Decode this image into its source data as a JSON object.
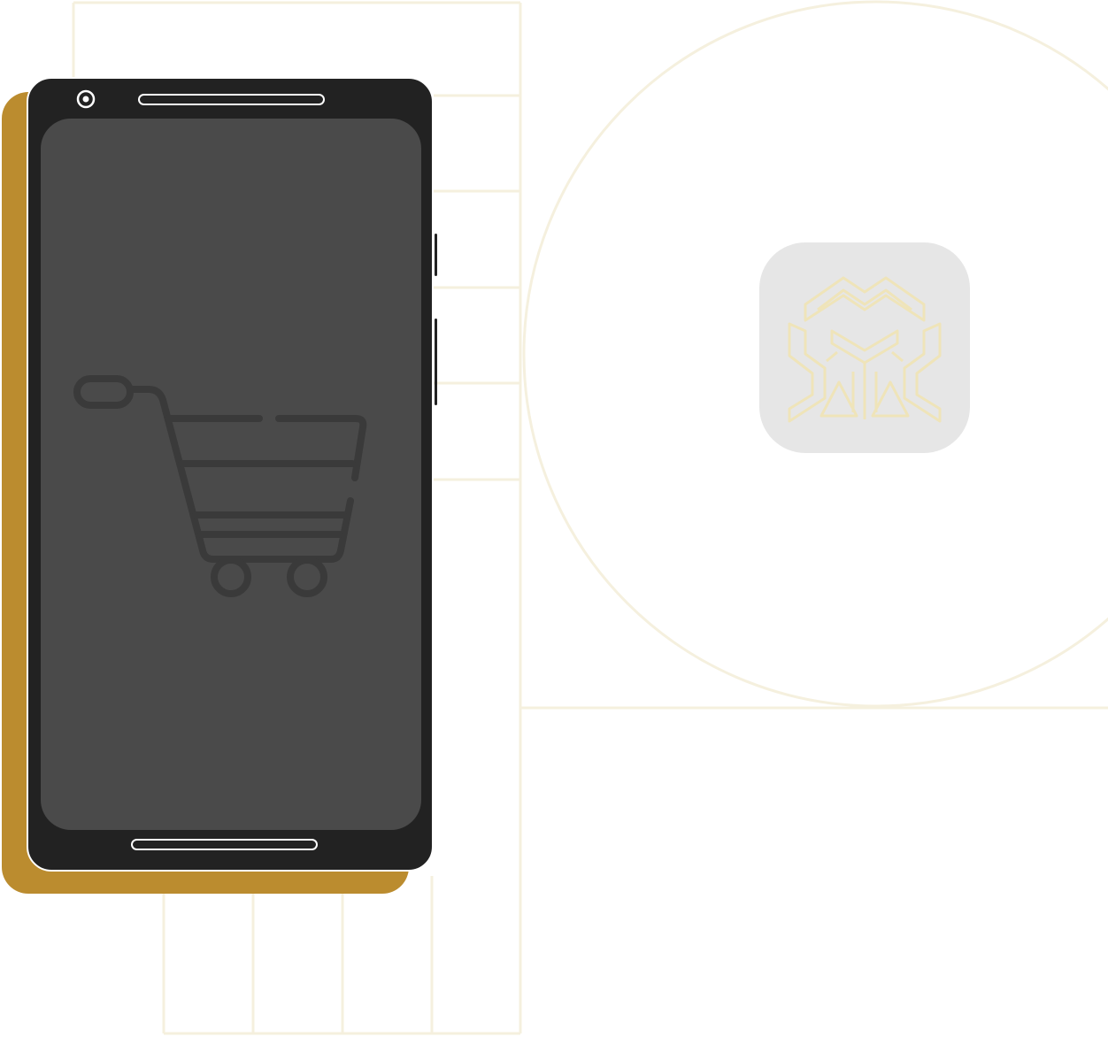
{
  "colors": {
    "background": "#ffffff",
    "grid_line": "#f5f0de",
    "phone_body": "#222222",
    "phone_screen": "#4a4a4a",
    "phone_shadow": "#bb8c2f",
    "cart_stroke": "#3a3a3a",
    "app_icon_bg": "#e6e6e6",
    "app_logo_stroke": "#efe4b9"
  },
  "icons": {
    "camera": "camera-icon",
    "cart": "shopping-cart-icon",
    "app_logo": "impossible-cube-logo"
  }
}
